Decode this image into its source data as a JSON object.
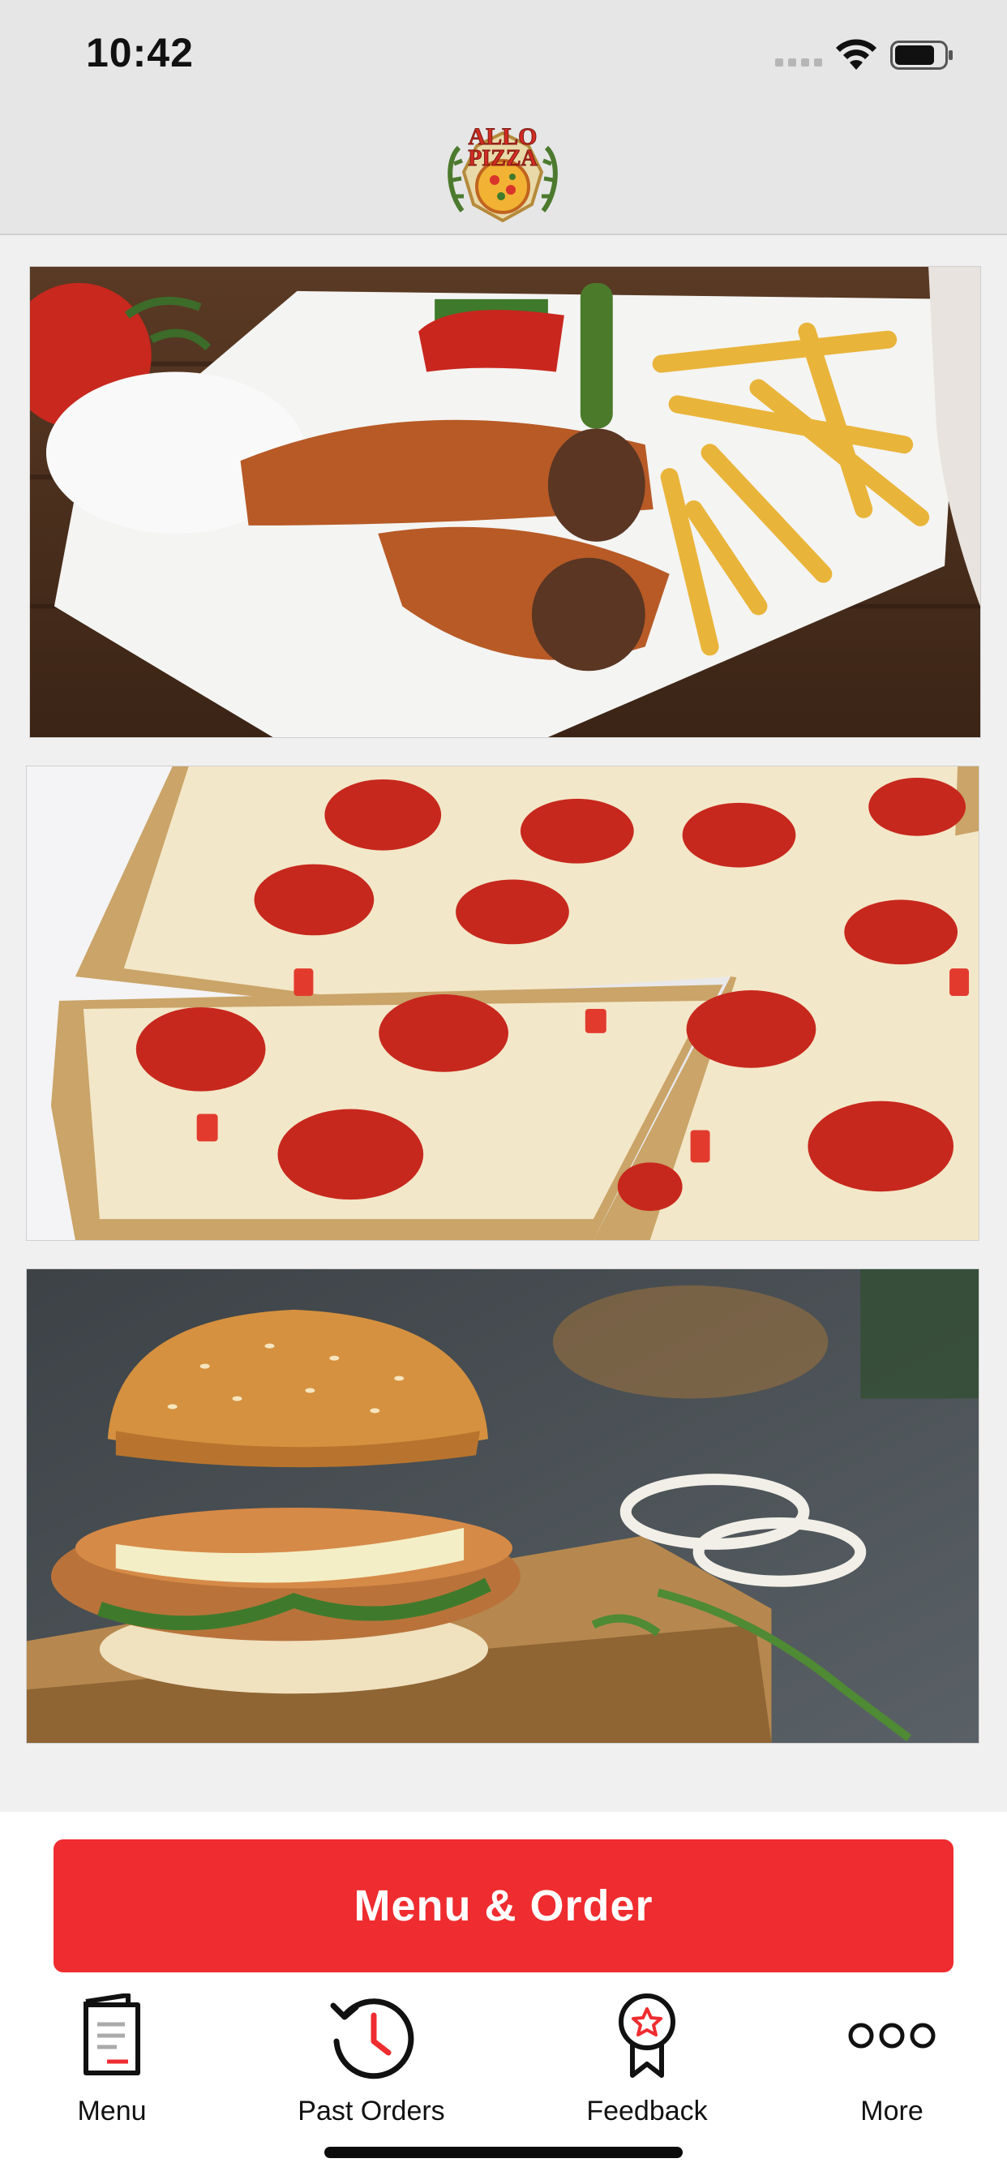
{
  "status_bar": {
    "time": "10:42"
  },
  "header": {
    "logo_text_line1": "ALLO",
    "logo_text_line2": "PIZZA"
  },
  "content": {
    "images": [
      {
        "name": "wrap-with-fries-image"
      },
      {
        "name": "pepperoni-pizza-image"
      },
      {
        "name": "chicken-burger-image"
      }
    ]
  },
  "actions": {
    "order_button_label": "Menu & Order"
  },
  "tabs": [
    {
      "label": "Menu",
      "icon": "menu-book-icon"
    },
    {
      "label": "Past Orders",
      "icon": "clock-history-icon"
    },
    {
      "label": "Feedback",
      "icon": "award-badge-icon"
    },
    {
      "label": "More",
      "icon": "more-dots-icon"
    }
  ],
  "colors": {
    "accent": "#ef2c2f",
    "header_bg": "#e6e6e6",
    "page_bg": "#f0f0f0"
  }
}
